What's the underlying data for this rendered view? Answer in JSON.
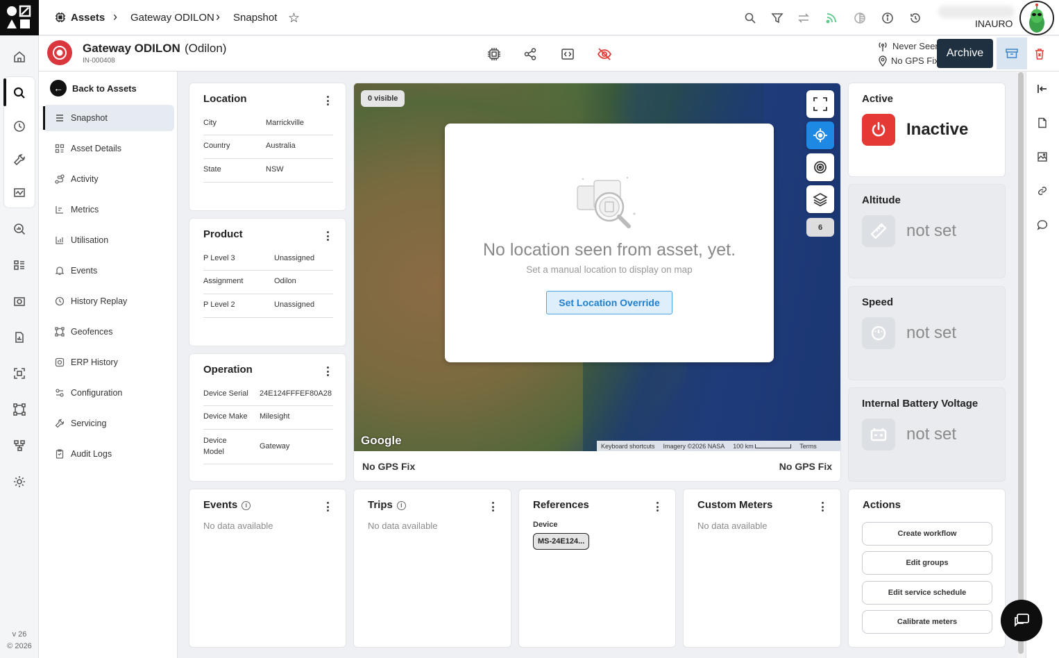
{
  "app": {
    "version": "v 26",
    "copyright": "© 2026"
  },
  "breadcrumb": {
    "root": "Assets",
    "asset": "Gateway ODILON",
    "page": "Snapshot"
  },
  "user": {
    "org": "INAURO"
  },
  "asset": {
    "name": "Gateway ODILON",
    "alias": "(Odilon)",
    "id": "IN-000408",
    "last_seen": "Never Seen",
    "gps": "No GPS Fix",
    "archive_tooltip": "Archive"
  },
  "sidebar": {
    "back_label": "Back to Assets",
    "items": [
      {
        "label": "Snapshot",
        "icon": "list-icon"
      },
      {
        "label": "Asset Details",
        "icon": "grid-icon"
      },
      {
        "label": "Activity",
        "icon": "route-icon"
      },
      {
        "label": "Metrics",
        "icon": "metrics-icon"
      },
      {
        "label": "Utilisation",
        "icon": "chart-icon"
      },
      {
        "label": "Events",
        "icon": "bell-icon"
      },
      {
        "label": "History Replay",
        "icon": "clock-icon"
      },
      {
        "label": "Geofences",
        "icon": "geofence-icon"
      },
      {
        "label": "ERP History",
        "icon": "erp-icon"
      },
      {
        "label": "Configuration",
        "icon": "config-icon"
      },
      {
        "label": "Servicing",
        "icon": "wrench-icon"
      },
      {
        "label": "Audit Logs",
        "icon": "audit-icon"
      }
    ]
  },
  "location": {
    "title": "Location",
    "rows": [
      {
        "k": "City",
        "v": "Marrickville"
      },
      {
        "k": "Country",
        "v": "Australia"
      },
      {
        "k": "State",
        "v": "NSW"
      }
    ]
  },
  "product": {
    "title": "Product",
    "rows": [
      {
        "k": "P Level 3",
        "v": "Unassigned"
      },
      {
        "k": "Assignment",
        "v": "Odilon"
      },
      {
        "k": "P Level 2",
        "v": "Unassigned"
      }
    ]
  },
  "operation": {
    "title": "Operation",
    "rows": [
      {
        "k": "Device Serial",
        "v": "24E124FFFEF80A28"
      },
      {
        "k": "Device Make",
        "v": "Milesight"
      },
      {
        "k": "Device Model",
        "v": "Gateway"
      }
    ]
  },
  "map": {
    "visible_tag": "0 visible",
    "layer_count": "6",
    "google": "Google",
    "attribution": {
      "shortcuts": "Keyboard shortcuts",
      "imagery": "Imagery ©2026 NASA",
      "scale": "100 km",
      "terms": "Terms"
    },
    "modal": {
      "title": "No location seen from asset, yet.",
      "subtitle": "Set a manual location to display on map",
      "button": "Set Location Override"
    },
    "footer_left": "No GPS Fix",
    "footer_right": "No GPS Fix"
  },
  "status": {
    "active": {
      "title": "Active",
      "value": "Inactive",
      "color": "#e53935"
    },
    "altitude": {
      "title": "Altitude",
      "value": "not set"
    },
    "speed": {
      "title": "Speed",
      "value": "not set"
    },
    "battery": {
      "title": "Internal Battery Voltage",
      "value": "not set"
    }
  },
  "events": {
    "title": "Events",
    "empty": "No data available"
  },
  "trips": {
    "title": "Trips",
    "empty": "No data available"
  },
  "references": {
    "title": "References",
    "label": "Device",
    "chip": "MS-24E124..."
  },
  "custom_meters": {
    "title": "Custom Meters",
    "empty": "No data available"
  },
  "actions": {
    "title": "Actions",
    "buttons": [
      "Create workflow",
      "Edit groups",
      "Edit service schedule",
      "Calibrate meters"
    ]
  }
}
